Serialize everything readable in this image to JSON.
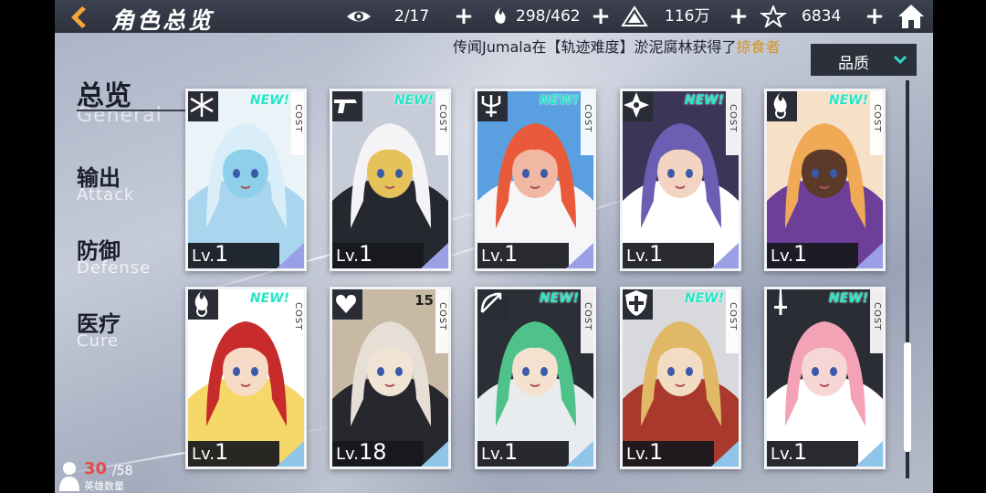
{
  "header": {
    "title": "角色总览",
    "resources": [
      {
        "icon": "eye-icon",
        "value": "2/17"
      },
      {
        "icon": "flame-icon",
        "value": "298/462"
      },
      {
        "icon": "triangle-rune-icon",
        "value": "116万"
      },
      {
        "icon": "star-crystal-icon",
        "value": "6834"
      }
    ]
  },
  "broadcast": {
    "text": "传闻Jumala在【轨迹难度】淤泥腐林获得了",
    "highlight": "掠食者"
  },
  "filter": {
    "label": "品质"
  },
  "categories": [
    {
      "cn": "总览",
      "en": "General"
    },
    {
      "cn": "输出",
      "en": "Attack"
    },
    {
      "cn": "防御",
      "en": "Defense"
    },
    {
      "cn": "医疗",
      "en": "Cure"
    }
  ],
  "hero_count": {
    "current": "30",
    "max": "/58",
    "label": "英雄数量"
  },
  "cards": [
    {
      "level_prefix": "Lv.",
      "level": "1",
      "cost_label": "COST",
      "cost": "",
      "new": "NEW!",
      "class_icon": "snowflake-icon",
      "accent": "#9aa0e6"
    },
    {
      "level_prefix": "Lv.",
      "level": "1",
      "cost_label": "COST",
      "cost": "",
      "new": "NEW!",
      "class_icon": "pistol-icon",
      "accent": "#9aa0e6"
    },
    {
      "level_prefix": "Lv.",
      "level": "1",
      "cost_label": "COST",
      "cost": "",
      "new": "NEW!",
      "class_icon": "trident-icon",
      "accent": "#9aa0e6"
    },
    {
      "level_prefix": "Lv.",
      "level": "1",
      "cost_label": "COST",
      "cost": "",
      "new": "NEW!",
      "class_icon": "shuriken-icon",
      "accent": "#9aa0e6"
    },
    {
      "level_prefix": "Lv.",
      "level": "1",
      "cost_label": "COST",
      "cost": "",
      "new": "NEW!",
      "class_icon": "fire-magic-icon",
      "accent": "#9aa0e6"
    },
    {
      "level_prefix": "Lv.",
      "level": "1",
      "cost_label": "COST",
      "cost": "",
      "new": "NEW!",
      "class_icon": "fire-magic-icon",
      "accent": "#8ec5e8"
    },
    {
      "level_prefix": "Lv.",
      "level": "18",
      "cost_label": "COST",
      "cost": "15",
      "new": "",
      "class_icon": "heart-wings-icon",
      "accent": "#8ec5e8"
    },
    {
      "level_prefix": "Lv.",
      "level": "1",
      "cost_label": "COST",
      "cost": "",
      "new": "NEW!",
      "class_icon": "bow-icon",
      "accent": "#8ec5e8"
    },
    {
      "level_prefix": "Lv.",
      "level": "1",
      "cost_label": "COST",
      "cost": "",
      "new": "NEW!",
      "class_icon": "cross-shield-icon",
      "accent": "#8ec5e8"
    },
    {
      "level_prefix": "Lv.",
      "level": "1",
      "cost_label": "COST",
      "cost": "",
      "new": "NEW!",
      "class_icon": "sword-icon",
      "accent": "#8ec5e8"
    }
  ]
}
